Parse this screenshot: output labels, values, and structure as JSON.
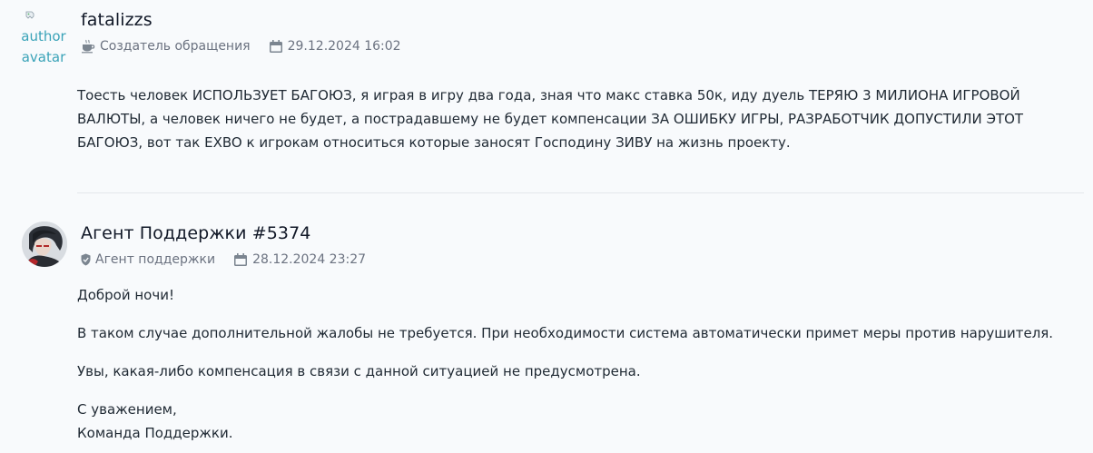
{
  "messages": [
    {
      "author": "fatalizzs",
      "avatar_alt": "author avatar",
      "role": "Создатель обращения",
      "role_icon": "coffee-cup-icon",
      "date": "29.12.2024 16:02",
      "date_icon": "calendar-icon",
      "body": [
        "Тоесть человек ИСПОЛЬЗУЕТ БАГОЮЗ, я играя в игру два года, зная что макс ставка 50к, иду дуель ТЕРЯЮ 3 МИЛИОНА ИГРОВОЙ ВАЛЮТЫ, а человек ничего не будет, а пострадавшему не будет компенсации ЗА ОШИБКУ ИГРЫ, РАЗРАБОТЧИК ДОПУСТИЛИ ЭТОТ БАГОЮЗ, вот так EXBO к игрокам относиться которые заносят Господину ЗИВУ на жизнь проекту."
      ]
    },
    {
      "author": "Агент Поддержки #5374",
      "role": "Агент поддержки",
      "role_icon": "shield-check-icon",
      "date": "28.12.2024 23:27",
      "date_icon": "calendar-icon",
      "body": [
        "Доброй ночи!",
        "В таком случае дополнительной жалобы не требуется. При необходимости система автоматически примет меры против нарушителя.",
        "Увы, какая-либо компенсация в связи с данной ситуацией не предусмотрена.",
        "С уважением,",
        "Команда Поддержки."
      ]
    }
  ],
  "colors": {
    "background": "#f8fafc",
    "text": "#1f2933",
    "meta": "#6b7280",
    "link_alt": "#3aa3b8"
  }
}
